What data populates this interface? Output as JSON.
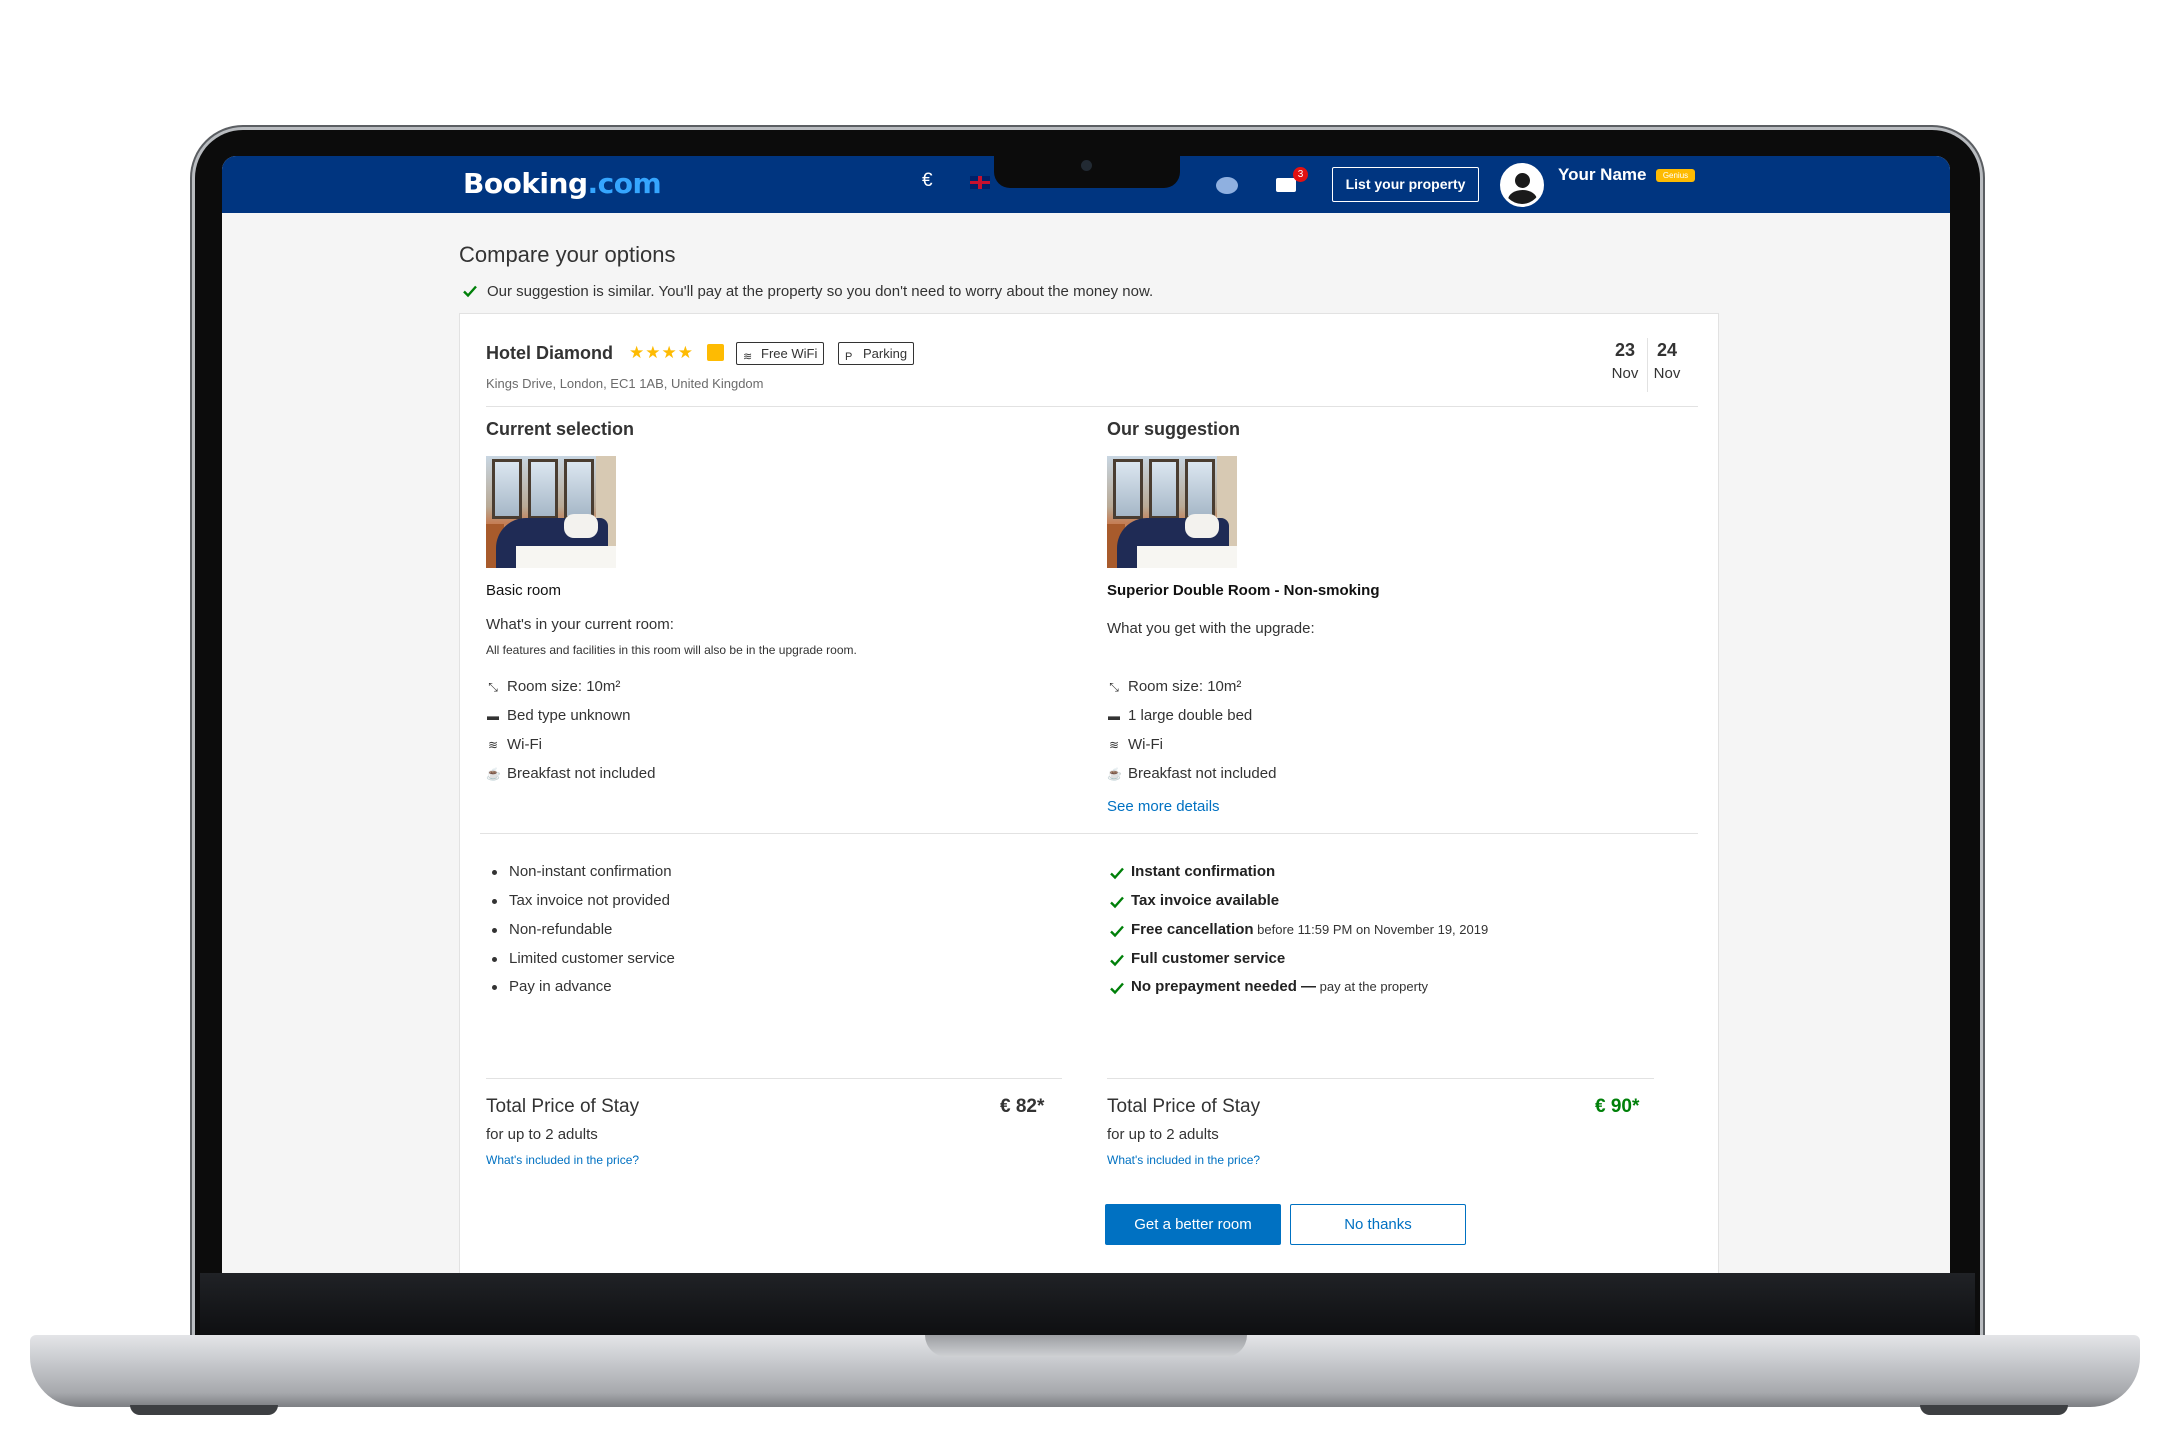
{
  "header": {
    "logo_main": "Booking",
    "logo_tld": ".com",
    "currency": "€",
    "list_property": "List your property",
    "messages_count": "3",
    "user_name": "Your Name",
    "genius_badge": "Genius"
  },
  "page": {
    "title": "Compare your options",
    "intro": "Our suggestion is similar. You'll pay at the property so you don't need to worry about the money now."
  },
  "hotel": {
    "name": "Hotel Diamond",
    "stars": "★★★★",
    "facilities": [
      "Free WiFi",
      "Parking"
    ],
    "address": "Kings Drive, London, EC1 1AB, United Kingdom",
    "checkin_day": "23",
    "checkin_month": "Nov",
    "checkout_day": "24",
    "checkout_month": "Nov"
  },
  "current": {
    "heading": "Current selection",
    "room_name": "Basic room",
    "section_title": "What's in your current room:",
    "note": "All features and facilities in this room will also be in the upgrade room.",
    "features": [
      "Room size: 10m²",
      "Bed type unknown",
      "Wi-Fi",
      "Breakfast not included"
    ],
    "conditions": [
      "Non-instant confirmation",
      "Tax invoice not provided",
      "Non-refundable",
      "Limited customer service",
      "Pay in advance"
    ],
    "price_label": "Total Price of Stay",
    "price_sub": "for up to 2 adults",
    "price_link": "What's included in the price?",
    "price": "€ 82*"
  },
  "suggestion": {
    "heading": "Our suggestion",
    "room_name": "Superior Double Room - Non-smoking",
    "section_title": "What you get with the upgrade:",
    "features": [
      "Room size: 10m²",
      "1 large double bed",
      "Wi-Fi",
      "Breakfast not included"
    ],
    "more_details": "See more details",
    "benefits": [
      {
        "title": "Instant confirmation",
        "sub": ""
      },
      {
        "title": "Tax invoice available",
        "sub": ""
      },
      {
        "title": "Free cancellation",
        "sub": " before 11:59 PM on November 19, 2019"
      },
      {
        "title": "Full customer service",
        "sub": ""
      },
      {
        "title": "No prepayment needed —",
        "sub": " pay at the property"
      }
    ],
    "price_label": "Total Price of Stay",
    "price_sub": "for up to 2 adults",
    "price_link": "What's included in the price?",
    "price": "€ 90*",
    "cta_primary": "Get a better room",
    "cta_secondary": "No thanks"
  },
  "colors": {
    "brand": "#003580",
    "link": "#0071c2",
    "success": "#008009",
    "star": "#febb02"
  },
  "icons": {
    "feature_icons": [
      "room-size-icon",
      "bed-icon",
      "wifi-icon",
      "breakfast-icon"
    ]
  }
}
